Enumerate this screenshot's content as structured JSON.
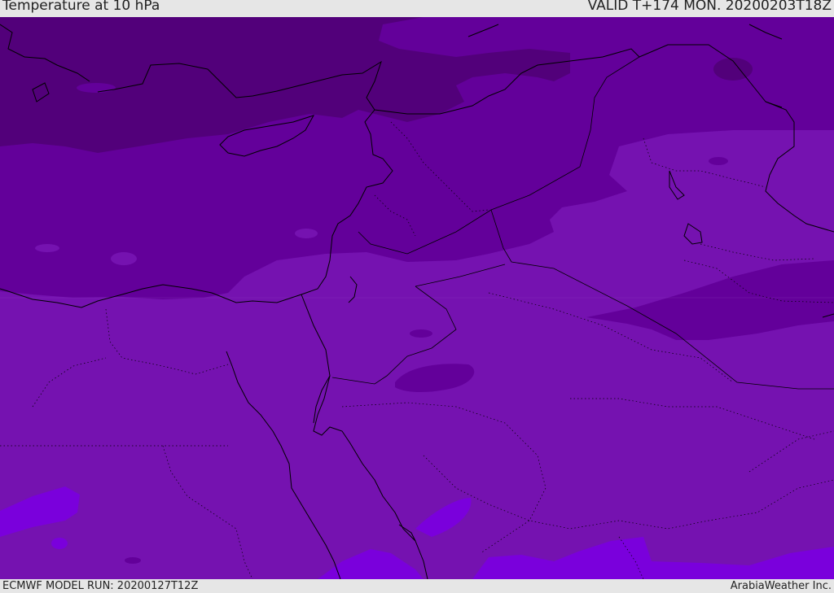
{
  "header": {
    "title": "Temperature at 10 hPa",
    "valid": "VALID T+174 MON. 20200203T18Z"
  },
  "footer": {
    "model_run": "ECMWF MODEL RUN: 20200127T12Z",
    "credit": "ArabiaWeather Inc."
  },
  "map": {
    "colors": {
      "darkest": "#52007a",
      "dark": "#63009a",
      "medium": "#7512b0",
      "light": "#7a00dc",
      "coast": "#000000"
    }
  }
}
